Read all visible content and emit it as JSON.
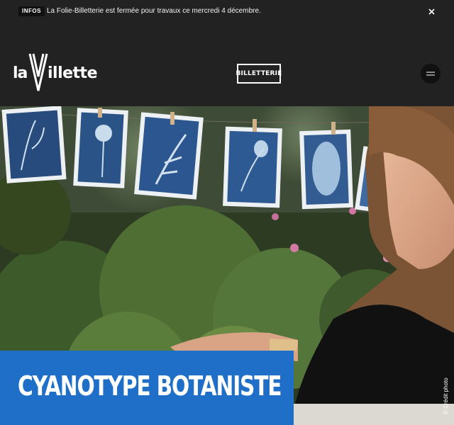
{
  "infobar": {
    "badge": "INFOS",
    "message": "La Folie-Billetterie est fermée pour travaux ce mercredi 4 décembre.",
    "close_icon": "close-icon"
  },
  "header": {
    "logo": "la Villette",
    "ticket_label": "BILLETTERIE",
    "menu_icon": "hamburger-icon"
  },
  "hero": {
    "title": "CYANOTYPE BOTANISTE",
    "credit": "© Crédit photo",
    "title_bg": "#1f6fc8"
  }
}
